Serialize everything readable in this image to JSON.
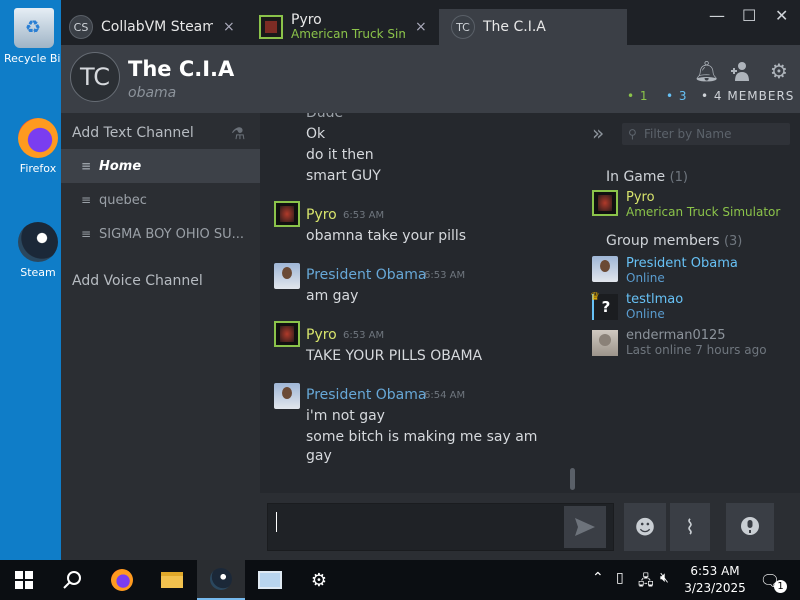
{
  "desktop": {
    "icons": [
      {
        "label": "Recycle Bin"
      },
      {
        "label": "Firefox"
      },
      {
        "label": "Steam"
      }
    ]
  },
  "tabs": [
    {
      "avatar_text": "CS",
      "label": "CollabVM Steam (",
      "close": "×"
    },
    {
      "label": "Pyro",
      "sub": "American Truck Simula",
      "close": "×"
    },
    {
      "avatar_text": "TC",
      "label": "The C.I.A"
    }
  ],
  "window_controls": {
    "minimize": "—",
    "maximize": "☐",
    "close": "✕"
  },
  "group": {
    "avatar_text": "TC",
    "title": "The C.I.A",
    "subtitle": "obama",
    "counts": {
      "in_game": "• 1",
      "online": "• 3",
      "members": "• 4 MEMBERS"
    },
    "colors": {
      "in_game": "#8bc34a",
      "online": "#67c1f5",
      "members": "#cfd3d8"
    }
  },
  "sidebar": {
    "add_text_channel": "Add Text Channel",
    "channels": [
      {
        "label": "Home",
        "active": true
      },
      {
        "label": "quebec",
        "active": false
      },
      {
        "label": "SIGMA BOY OHIO SU...",
        "active": false
      }
    ],
    "add_voice_channel": "Add Voice Channel"
  },
  "chat": {
    "top_lines": [
      "Dude",
      "Ok",
      "do it then",
      "smart GUY"
    ],
    "messages": [
      {
        "author": "Pyro",
        "time": "6:53 AM",
        "lines": [
          "obamna take your pills"
        ],
        "color": "#d8e46c"
      },
      {
        "author": "President Obama",
        "time": "6:53 AM",
        "lines": [
          "am gay"
        ],
        "color": "#67a8d8"
      },
      {
        "author": "Pyro",
        "time": "6:53 AM",
        "lines": [
          "TAKE YOUR PILLS OBAMA"
        ],
        "color": "#d8e46c"
      },
      {
        "author": "President Obama",
        "time": "6:54 AM",
        "lines": [
          "i'm not gay",
          "some bitch is making me say am",
          "gay"
        ],
        "color": "#67a8d8"
      }
    ]
  },
  "member_panel": {
    "filter_placeholder": "Filter by Name",
    "in_game_label": "In Game",
    "in_game_count": "(1)",
    "group_members_label": "Group members",
    "group_members_count": "(3)",
    "in_game": [
      {
        "name": "Pyro",
        "status": "American Truck Simulator"
      }
    ],
    "members": [
      {
        "name": "President Obama",
        "status": "Online"
      },
      {
        "name": "testlmao",
        "status": "Online"
      },
      {
        "name": "enderman0125",
        "status": "Last online 7 hours ago"
      }
    ]
  },
  "input": {
    "value": ""
  },
  "taskbar": {
    "time": "6:53 AM",
    "date": "3/23/2025",
    "notification_count": "1"
  }
}
